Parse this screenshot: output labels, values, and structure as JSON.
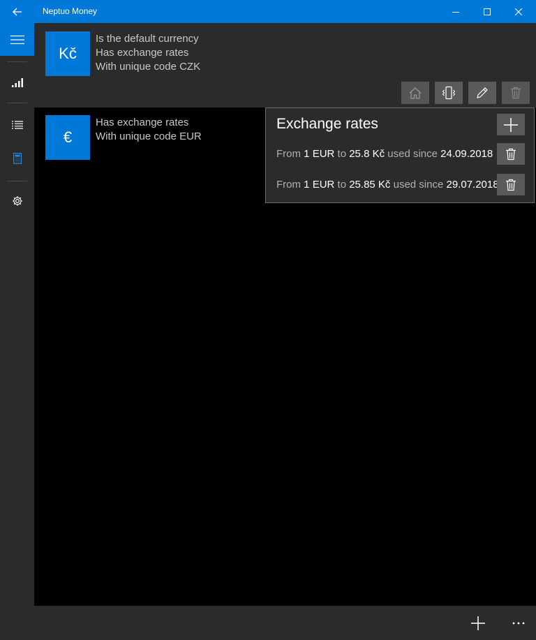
{
  "window": {
    "title": "Neptuo Money",
    "accent": "#0078d7"
  },
  "nav": {
    "items": [
      {
        "icon": "hamburger-icon"
      },
      {
        "icon": "signal-bars-icon"
      },
      {
        "icon": "list-icon"
      },
      {
        "icon": "calculator-icon"
      },
      {
        "icon": "gear-icon"
      }
    ]
  },
  "currencies": [
    {
      "symbol": "Kč",
      "lines": [
        "Is the default currency",
        "Has exchange rates",
        "With unique code CZK"
      ],
      "actions": [
        "home-icon",
        "phone-vibrate-icon",
        "pencil-icon",
        "trash-icon"
      ]
    },
    {
      "symbol": "€",
      "lines": [
        "Has exchange rates",
        "With unique code EUR"
      ]
    }
  ],
  "exchange_rates": {
    "title": "Exchange rates",
    "rows": [
      {
        "from_word": "From",
        "amount": "1",
        "source": "EUR",
        "to_word": "to",
        "rate": "25.8 Kč",
        "since_word": "used since",
        "date": "24.09.2018"
      },
      {
        "from_word": "From",
        "amount": "1",
        "source": "EUR",
        "to_word": "to",
        "rate": "25.85 Kč",
        "since_word": "used since",
        "date": "29.07.2018"
      }
    ]
  },
  "command_bar": {
    "buttons": [
      "add-icon",
      "more-icon"
    ]
  }
}
